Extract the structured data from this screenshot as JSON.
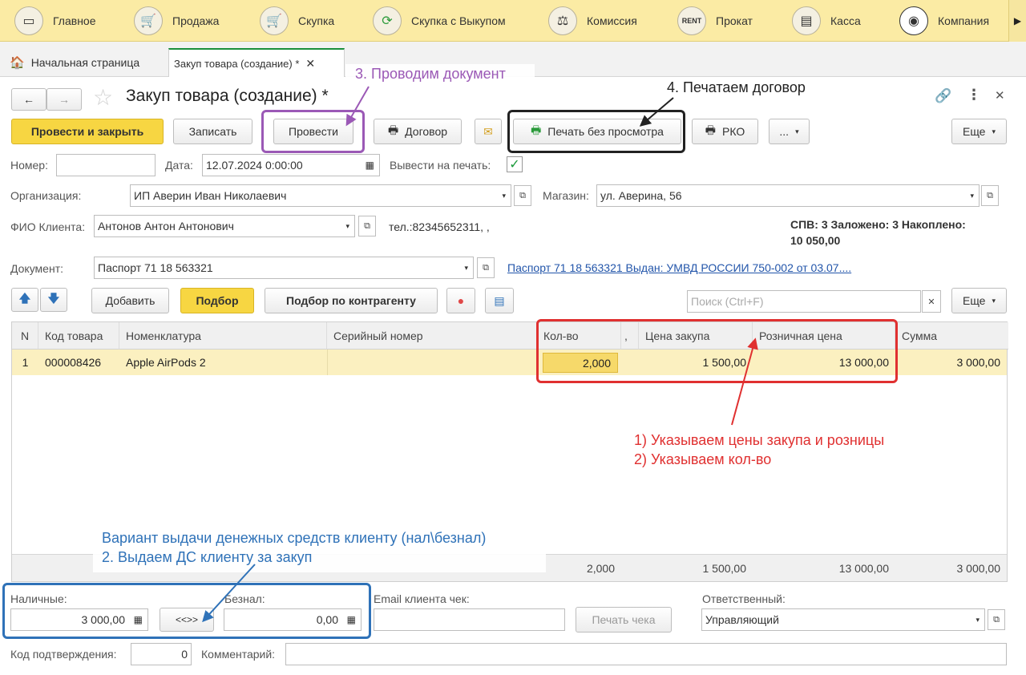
{
  "nav": [
    {
      "label": "Главное",
      "icon": "home-monitor-icon"
    },
    {
      "label": "Продажа",
      "icon": "cart-icon"
    },
    {
      "label": "Скупка",
      "icon": "basket-icon"
    },
    {
      "label": "Скупка с Выкупом",
      "icon": "refresh-icon"
    },
    {
      "label": "Комиссия",
      "icon": "scales-icon"
    },
    {
      "label": "Прокат",
      "icon": "rent-icon"
    },
    {
      "label": "Касса",
      "icon": "cash-register-icon"
    },
    {
      "label": "Компания",
      "icon": "company-icon"
    }
  ],
  "tabs": {
    "home": "Начальная страница",
    "doc": "Закуп товара (создание) *"
  },
  "title": "Закуп товара (создание) *",
  "toolbar": {
    "post_close": "Провести и закрыть",
    "save": "Записать",
    "post": "Провести",
    "contract": "Договор",
    "print_no_preview": "Печать без просмотра",
    "rko": "РКО",
    "more": "...",
    "eshe": "Еще"
  },
  "form": {
    "number_label": "Номер:",
    "number_value": "",
    "date_label": "Дата:",
    "date_value": "12.07.2024  0:00:00",
    "print_label": "Вывести на печать:",
    "org_label": "Организация:",
    "org_value": "ИП Аверин Иван Николаевич",
    "shop_label": "Магазин:",
    "shop_value": "ул. Аверина, 56",
    "client_label": "ФИО Клиента:",
    "client_value": "Антонов Антон Антонович",
    "phone": "тел.:82345652311, ,",
    "stats": "СПВ: 3 Заложено: 3 Накоплено:",
    "stats2": "10 050,00",
    "doc_label": "Документ:",
    "doc_value": "Паспорт 71 18 563321",
    "doc_link": "Паспорт 71 18 563321 Выдан: УМВД РОССИИ 750-002 от 03.07...."
  },
  "tabletools": {
    "add": "Добавить",
    "pick": "Подбор",
    "pick_contr": "Подбор по контрагенту",
    "search_placeholder": "Поиск (Ctrl+F)",
    "eshe": "Еще"
  },
  "table": {
    "headers": [
      "N",
      "Код товара",
      "Номенклатура",
      "Серийный номер",
      "Кол-во",
      ",",
      "Цена закупа",
      "Розничная цена",
      "Сумма"
    ],
    "rows": [
      {
        "n": "1",
        "code": "000008426",
        "name": "Apple AirPods 2",
        "serial": "",
        "qty": "2,000",
        "price": "1 500,00",
        "retail": "13 000,00",
        "sum": "3 000,00"
      }
    ],
    "footer": {
      "qty": "2,000",
      "price": "1 500,00",
      "retail": "13 000,00",
      "sum": "3 000,00"
    }
  },
  "bottom": {
    "cash_label": "Наличные:",
    "cash_value": "3 000,00",
    "swap": "<<>>",
    "card_label": "Безнал:",
    "card_value": "0,00",
    "email_label": "Email клиента чек:",
    "email_value": "",
    "print_check": "Печать чека",
    "resp_label": "Ответственный:",
    "resp_value": "Управляющий",
    "code_label": "Код подтверждения:",
    "code_value": "0",
    "comment_label": "Комментарий:",
    "comment_value": ""
  },
  "annotations": {
    "a3": "3. Проводим документ",
    "a4": "4. Печатаем договор",
    "a1": "1) Указываем цены закупа и розницы",
    "a2": "2) Указываем кол-во",
    "ab1": "Вариант выдачи денежных средств клиенту (нал\\безнал)",
    "ab2": "2. Выдаем ДС клиенту за закуп"
  },
  "colors": {
    "accent_yellow": "#f7d642",
    "annot_purple": "#9b59b6",
    "annot_red": "#e03030",
    "annot_blue": "#2f72b8",
    "annot_black": "#222222"
  }
}
